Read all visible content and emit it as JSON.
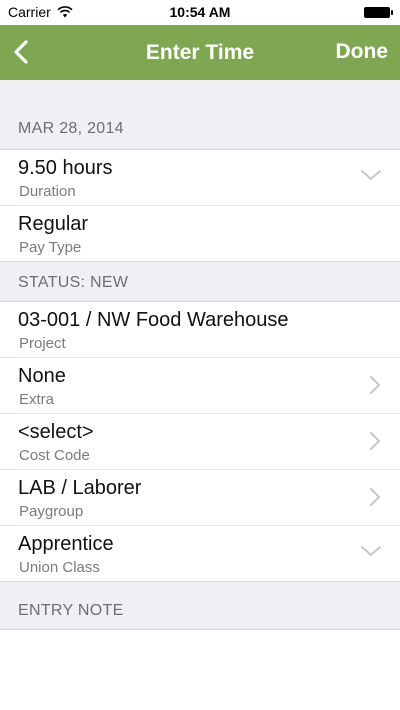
{
  "status_bar": {
    "carrier": "Carrier",
    "time": "10:54 AM",
    "icons": [
      "wifi-icon",
      "battery-icon"
    ]
  },
  "nav": {
    "title": "Enter Time",
    "done_label": "Done",
    "back_icon": "chevron-left-icon",
    "color": "#7fa651"
  },
  "sections": {
    "date_header": "MAR 28, 2014",
    "status_header": "STATUS: NEW",
    "note_header": "ENTRY NOTE"
  },
  "rows": {
    "duration": {
      "value": "9.50 hours",
      "label": "Duration",
      "icon": "chevron-down-icon"
    },
    "pay_type": {
      "value": "Regular",
      "label": "Pay Type"
    },
    "project": {
      "value": "03-001 / NW Food Warehouse",
      "label": "Project"
    },
    "extra": {
      "value": "None",
      "label": "Extra",
      "icon": "chevron-right-icon"
    },
    "cost_code": {
      "value": "<select>",
      "label": "Cost Code",
      "icon": "chevron-right-icon"
    },
    "paygroup": {
      "value": "LAB / Laborer",
      "label": "Paygroup",
      "icon": "chevron-right-icon"
    },
    "union_class": {
      "value": "Apprentice",
      "label": "Union Class",
      "icon": "chevron-down-icon"
    }
  }
}
